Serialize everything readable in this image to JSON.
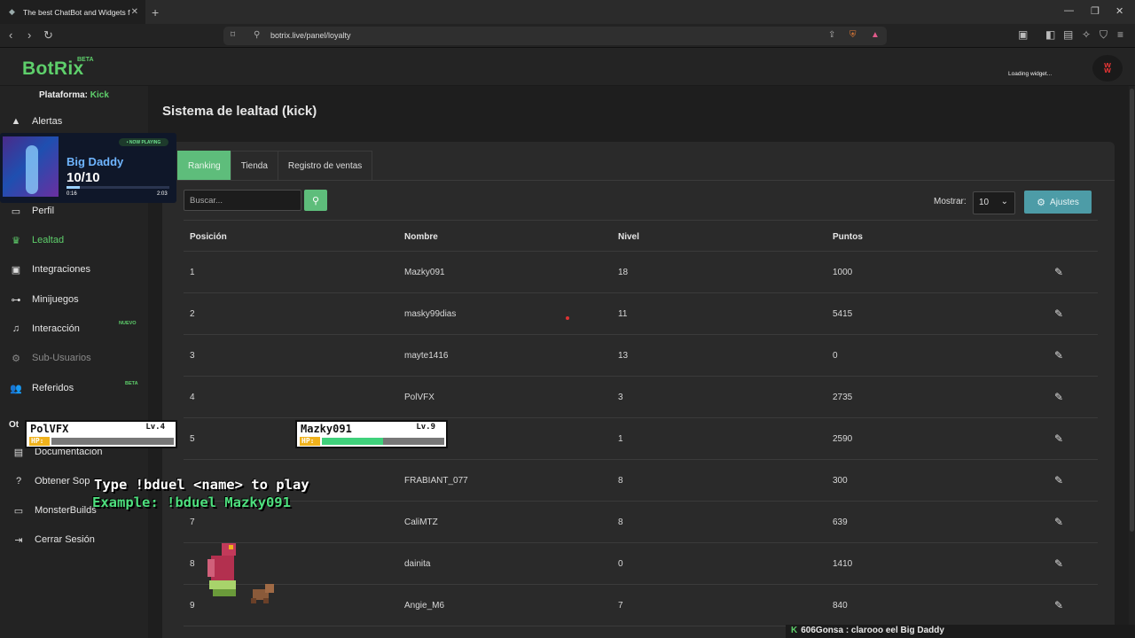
{
  "browser": {
    "tab_title": "The best ChatBot and Widgets f",
    "url": "botrix.live/panel/loyalty",
    "new_tab_symbol": "+",
    "icons": [
      "back-icon",
      "forward-icon",
      "reload-icon",
      "bookmark-icon",
      "site-info-icon",
      "share-icon",
      "brave-shield-icon",
      "rewards-icon",
      "reader-icon",
      "sidebar-icon",
      "wallet-icon",
      "leo-icon",
      "vpn-icon",
      "menu-icon"
    ]
  },
  "site": {
    "logo": "BotRix",
    "logo_badge": "BETA",
    "loading_text": "Loading widget...",
    "avatar_icon": "grin-face-icon",
    "brand_color": "#5ecf6b"
  },
  "sidebar": {
    "platform_label": "Plataforma:",
    "platform_value": "Kick",
    "items": [
      {
        "label": "Alertas",
        "icon": "warning-icon"
      },
      {
        "label": "Perfil",
        "icon": "id-card-icon"
      },
      {
        "label": "Lealtad",
        "icon": "trophy-icon",
        "active": true
      },
      {
        "label": "Integraciones",
        "icon": "plug-icon"
      },
      {
        "label": "Minijuegos",
        "icon": "gamepad-icon"
      },
      {
        "label": "Interacción",
        "icon": "music-icon",
        "badge": "NUEVO"
      },
      {
        "label": "Sub-Usuarios",
        "icon": "cog-icon",
        "disabled": true
      },
      {
        "label": "Referidos",
        "icon": "users-icon",
        "badge": "BETA"
      }
    ],
    "section_label": "Ot",
    "other_items": [
      {
        "label": "Documentacion",
        "icon": "book-icon"
      },
      {
        "label": "Obtener Sop",
        "icon": "help-icon"
      },
      {
        "label": "MonsterBuilds",
        "icon": "monitor-icon"
      },
      {
        "label": "Cerrar Sesión",
        "icon": "logout-icon"
      }
    ]
  },
  "main": {
    "title": "Sistema de lealtad (kick)",
    "tabs": [
      {
        "label": "Ranking",
        "active": true
      },
      {
        "label": "Tienda"
      },
      {
        "label": "Registro de ventas"
      }
    ],
    "search_placeholder": "Buscar...",
    "show_label": "Mostrar:",
    "show_value": "10",
    "settings_label": "Ajustes",
    "columns": [
      "Posición",
      "Nombre",
      "Nivel",
      "Puntos"
    ],
    "rows": [
      {
        "pos": "1",
        "name": "Mazky091",
        "level": "18",
        "points": "1000"
      },
      {
        "pos": "2",
        "name": "masky99dias",
        "level": "11",
        "points": "5415"
      },
      {
        "pos": "3",
        "name": "mayte1416",
        "level": "13",
        "points": "0"
      },
      {
        "pos": "4",
        "name": "PolVFX",
        "level": "3",
        "points": "2735"
      },
      {
        "pos": "5",
        "name": "",
        "level": "1",
        "points": "2590"
      },
      {
        "pos": "",
        "name": "FRABIANT_077",
        "level": "8",
        "points": "300"
      },
      {
        "pos": "7",
        "name": "CaliMTZ",
        "level": "8",
        "points": "639"
      },
      {
        "pos": "8",
        "name": "dainita",
        "level": "0",
        "points": "1410"
      },
      {
        "pos": "9",
        "name": "Angie_M6",
        "level": "7",
        "points": "840"
      }
    ]
  },
  "overlays": {
    "now_playing": {
      "badge": "• NOW PLAYING",
      "song": "Big Daddy",
      "score": "10/10",
      "time_elapsed": "0:16",
      "time_total": "2:03",
      "progress": 0.13
    },
    "fighters": [
      {
        "name": "PolVFX",
        "level": "Lv.4",
        "hp_label": "HP:",
        "hp": 0.0
      },
      {
        "name": "Mazky091",
        "level": "Lv.9",
        "hp_label": "HP:",
        "hp": 0.5
      }
    ],
    "duel_line1": "Type !bduel <name> to play",
    "duel_line2": "Example: !bduel Mazky091",
    "chat_user": "606Gonsa",
    "chat_message": " : clarooo eel Big Daddy"
  }
}
